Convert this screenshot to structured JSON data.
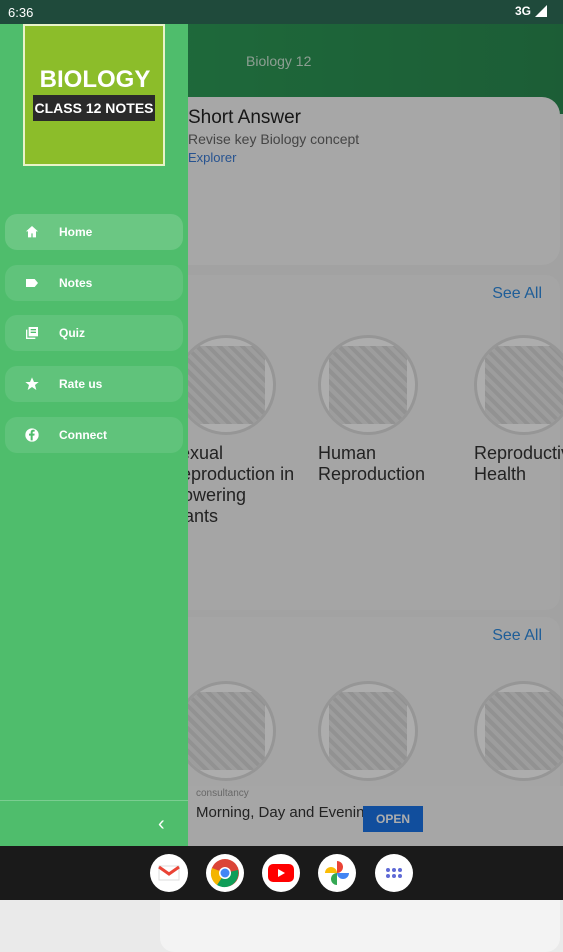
{
  "status": {
    "time": "6:36",
    "network": "3G"
  },
  "app": {
    "title": "Biology 12",
    "card": {
      "heading": "Short Answer",
      "subtitle": "Revise key Biology concept",
      "link": "Explorer"
    },
    "section1": {
      "see_all": "See All",
      "items": [
        {
          "label": "Sexual Reproduction in Flowering Plants"
        },
        {
          "label": "Human Reproduction"
        },
        {
          "label": "Reproductive Health"
        }
      ]
    },
    "section2": {
      "see_all": "See All"
    },
    "ad": {
      "small": "consultancy",
      "text": "Morning, Day and Evening",
      "open": "OPEN"
    }
  },
  "drawer": {
    "logo_title": "BIOLOGY",
    "logo_subtitle": "CLASS 12 NOTES",
    "items": [
      {
        "label": "Home",
        "icon": "home-icon",
        "active": true
      },
      {
        "label": "Notes",
        "icon": "label-icon",
        "active": false
      },
      {
        "label": "Quiz",
        "icon": "library-books-icon",
        "active": false
      },
      {
        "label": "Rate us",
        "icon": "star-icon",
        "active": false
      },
      {
        "label": "Connect",
        "icon": "facebook-icon",
        "active": false
      }
    ],
    "collapse_icon": "chevron-left-icon"
  },
  "dock": [
    "gmail-icon",
    "chrome-icon",
    "youtube-icon",
    "photos-icon",
    "apps-icon"
  ],
  "colors": {
    "drawer": "#4fbd6c",
    "header": "#2fa35a",
    "link": "#2f8be0"
  }
}
